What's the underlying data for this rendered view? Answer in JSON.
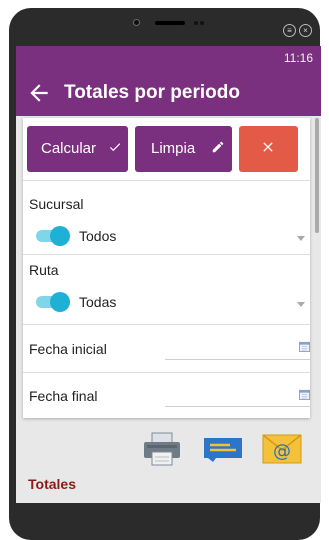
{
  "status_bar": {
    "time": "11:16"
  },
  "app_bar": {
    "title": "Totales por periodo"
  },
  "buttons": {
    "calcular": "Calcular",
    "limpia": "Limpia"
  },
  "fields": {
    "sucursal": {
      "label": "Sucursal",
      "value": "Todos",
      "toggle_on": true
    },
    "ruta": {
      "label": "Ruta",
      "value": "Todas",
      "toggle_on": true
    },
    "fecha_inicial": {
      "label": "Fecha inicial",
      "value": ""
    },
    "fecha_final": {
      "label": "Fecha final",
      "value": ""
    }
  },
  "section": {
    "totales": "Totales"
  },
  "colors": {
    "primary": "#7b2f7f",
    "cancel": "#e35a47",
    "toggle_track": "#7fd6e8",
    "toggle_knob": "#1fb0d6",
    "section_title": "#8b1a1a"
  },
  "icons": [
    "back-arrow-icon",
    "check-icon",
    "pencil-icon",
    "close-icon",
    "chevron-down-icon",
    "calendar-icon",
    "printer-icon",
    "message-icon",
    "email-icon"
  ]
}
